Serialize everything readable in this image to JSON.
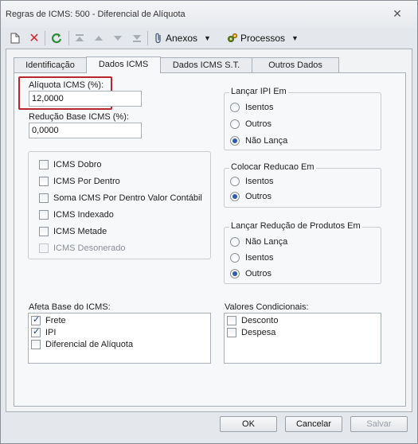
{
  "window": {
    "title": "Regras de ICMS: 500 - Diferencial de Alíquota"
  },
  "toolbar": {
    "new_icon": "new-document-icon",
    "delete_icon": "delete-x-icon",
    "refresh_icon": "refresh-icon",
    "nav_icons": [
      "first-record-icon",
      "previous-record-icon",
      "next-record-icon",
      "last-record-icon"
    ],
    "anexos_label": "Anexos",
    "processos_label": "Processos"
  },
  "tabs": [
    "Identificação",
    "Dados ICMS",
    "Dados ICMS S.T.",
    "Outros Dados"
  ],
  "active_tab": "Dados ICMS",
  "fields": {
    "aliquota_label": "Alíquota ICMS (%):",
    "aliquota_value": "12,0000",
    "reducao_label": "Redução Base ICMS (%):",
    "reducao_value": "0,0000"
  },
  "icms_options": [
    {
      "label": "ICMS Dobro",
      "checked": false,
      "enabled": true
    },
    {
      "label": "ICMS Por Dentro",
      "checked": false,
      "enabled": true
    },
    {
      "label": "Soma ICMS Por Dentro Valor Contábil",
      "checked": false,
      "enabled": true
    },
    {
      "label": "ICMS Indexado",
      "checked": false,
      "enabled": true
    },
    {
      "label": "ICMS Metade",
      "checked": false,
      "enabled": true
    },
    {
      "label": "ICMS Desonerado",
      "checked": false,
      "enabled": false
    }
  ],
  "lancar_ipi": {
    "title": "Lançar IPI Em",
    "options": [
      "Isentos",
      "Outros",
      "Não Lança"
    ],
    "selected": "Não Lança"
  },
  "colocar_reducao": {
    "title": "Colocar Reducao Em",
    "options": [
      "Isentos",
      "Outros"
    ],
    "selected": "Outros"
  },
  "lancar_reducao_produtos": {
    "title": "Lançar Redução de Produtos Em",
    "options": [
      "Não Lança",
      "Isentos",
      "Outros"
    ],
    "selected": "Outros"
  },
  "afeta_base": {
    "title": "Afeta Base do ICMS:",
    "items": [
      {
        "label": "Frete",
        "checked": true
      },
      {
        "label": "IPI",
        "checked": true
      },
      {
        "label": "Diferencial de Alíquota",
        "checked": false
      }
    ]
  },
  "valores_condicionais": {
    "title": "Valores Condicionais:",
    "items": [
      {
        "label": "Desconto",
        "checked": false
      },
      {
        "label": "Despesa",
        "checked": false
      }
    ]
  },
  "footer": {
    "ok": "OK",
    "cancel": "Cancelar",
    "save": "Salvar"
  },
  "colors": {
    "highlight": "#b8272b",
    "delete_red": "#d6282c",
    "refresh_green": "#2e8b3a"
  }
}
